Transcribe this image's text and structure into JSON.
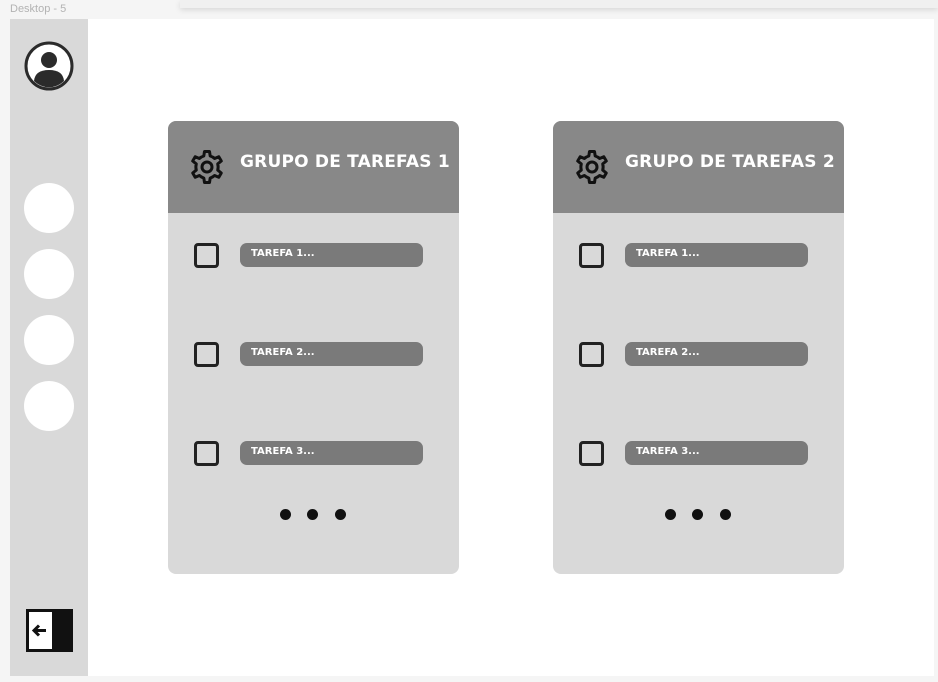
{
  "frame": {
    "label": "Desktop - 5"
  },
  "sidebar": {
    "avatar_icon": "user-circle-icon",
    "nav_items": [
      {
        "icon": "circle"
      },
      {
        "icon": "circle"
      },
      {
        "icon": "circle"
      },
      {
        "icon": "circle"
      }
    ],
    "collapse_icon": "collapse-sidebar-icon"
  },
  "groups": [
    {
      "title": "GRUPO DE TAREFAS 1",
      "settings_icon": "gear-icon",
      "tasks": [
        {
          "label": "TAREFA 1..."
        },
        {
          "label": "TAREFA 2..."
        },
        {
          "label": "TAREFA 3..."
        }
      ],
      "more_icon": "more-horizontal-icon"
    },
    {
      "title": "GRUPO DE TAREFAS 2",
      "settings_icon": "gear-icon",
      "tasks": [
        {
          "label": "TAREFA 1..."
        },
        {
          "label": "TAREFA 2..."
        },
        {
          "label": "TAREFA 3..."
        }
      ],
      "more_icon": "more-horizontal-icon"
    }
  ],
  "colors": {
    "sidebar_bg": "#d9d9d9",
    "card_bg": "#d9d9d9",
    "card_header": "#888888",
    "task_pill": "#7a7a7a",
    "text_light": "#ffffff",
    "ink": "#222222"
  }
}
